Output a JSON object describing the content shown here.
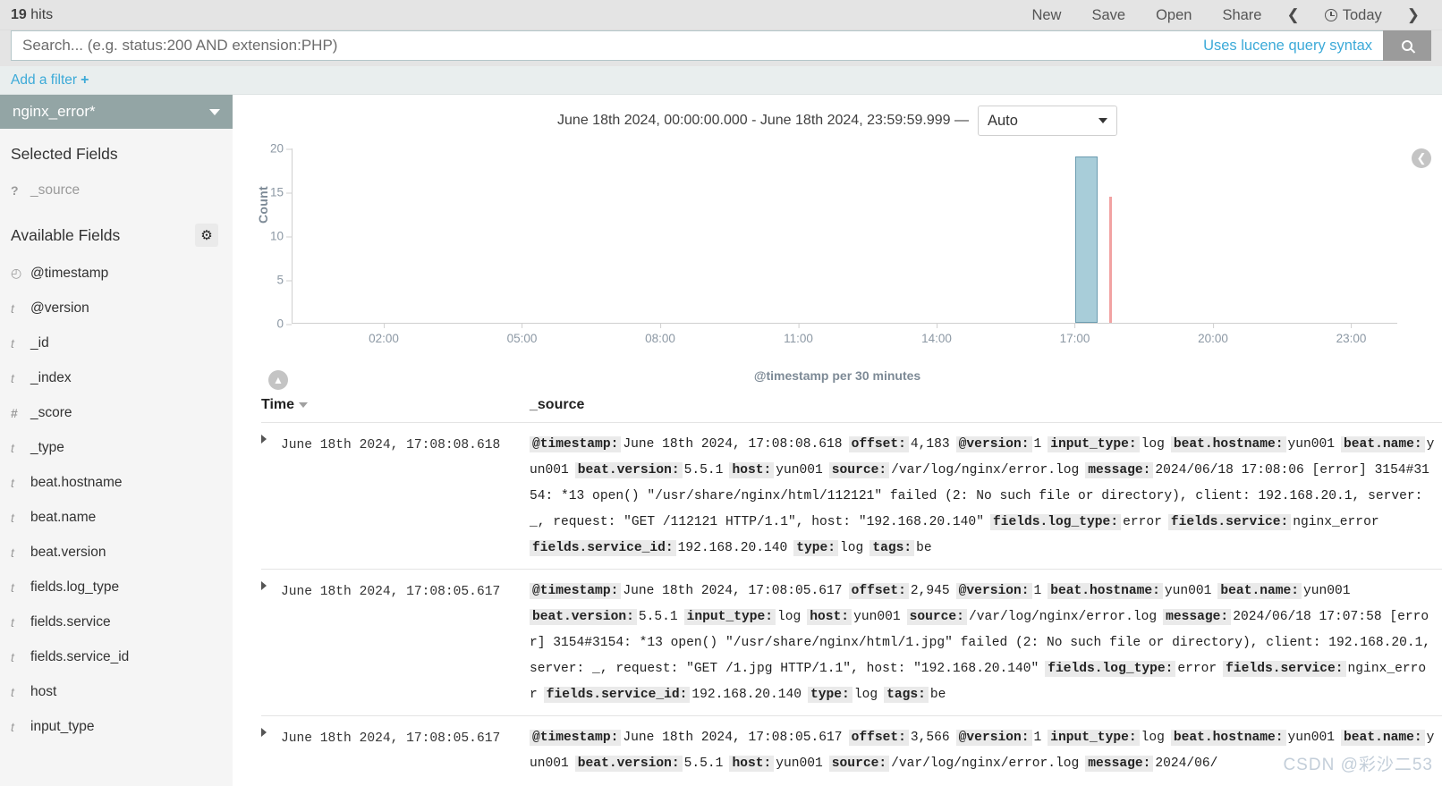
{
  "header": {
    "hits_count": "19",
    "hits_label": "hits",
    "nav": [
      {
        "label": "New",
        "name": "new-button"
      },
      {
        "label": "Save",
        "name": "save-button"
      },
      {
        "label": "Open",
        "name": "open-button"
      },
      {
        "label": "Share",
        "name": "share-button"
      }
    ],
    "prev_arrow": "❮",
    "next_arrow": "❯",
    "time_picker_label": "Today"
  },
  "search": {
    "placeholder": "Search... (e.g. status:200 AND extension:PHP)",
    "value": "",
    "hint": "Uses lucene query syntax",
    "button_icon": "search-icon"
  },
  "filters": {
    "add_filter_label": "Add a filter",
    "plus": "+"
  },
  "sidebar": {
    "index_pattern": "nginx_error*",
    "selected_fields_title": "Selected Fields",
    "selected_fields": [
      {
        "type": "?",
        "name": "_source"
      }
    ],
    "available_fields_title": "Available Fields",
    "settings_icon": "gear-icon",
    "available_fields": [
      {
        "type": "clock",
        "name": "@timestamp"
      },
      {
        "type": "t",
        "name": "@version"
      },
      {
        "type": "t",
        "name": "_id"
      },
      {
        "type": "t",
        "name": "_index"
      },
      {
        "type": "#",
        "name": "_score"
      },
      {
        "type": "t",
        "name": "_type"
      },
      {
        "type": "t",
        "name": "beat.hostname"
      },
      {
        "type": "t",
        "name": "beat.name"
      },
      {
        "type": "t",
        "name": "beat.version"
      },
      {
        "type": "t",
        "name": "fields.log_type"
      },
      {
        "type": "t",
        "name": "fields.service"
      },
      {
        "type": "t",
        "name": "fields.service_id"
      },
      {
        "type": "t",
        "name": "host"
      },
      {
        "type": "t",
        "name": "input_type"
      }
    ],
    "collapse_icon": "chevron-left-icon"
  },
  "chart": {
    "time_range": "June 18th 2024, 00:00:00.000 - June 18th 2024, 23:59:59.999 —",
    "interval_value": "Auto",
    "collapse_left_icon": "chevron-up-icon",
    "collapse_right_icon": "chevron-left-icon"
  },
  "chart_data": {
    "type": "bar",
    "title": "",
    "xlabel": "@timestamp per 30 minutes",
    "ylabel": "Count",
    "xtick_labels": [
      "02:00",
      "05:00",
      "08:00",
      "11:00",
      "14:00",
      "17:00",
      "20:00",
      "23:00"
    ],
    "xtick_hours": [
      2,
      5,
      8,
      11,
      14,
      17,
      20,
      23
    ],
    "ytick_labels": [
      "0",
      "5",
      "10",
      "15",
      "20"
    ],
    "ylim": [
      0,
      20
    ],
    "xlim_hours": [
      0,
      24
    ],
    "grid": false,
    "legend": null,
    "bars": [
      {
        "x_hour": 17.0,
        "width_hours": 0.5,
        "value": 19
      }
    ],
    "markers": [
      {
        "type": "current-time-line",
        "x_hour": 17.75,
        "color": "#f2a2a2"
      }
    ],
    "bar_color": "#a8cdd9",
    "bar_border_color": "#6b9cb0"
  },
  "table": {
    "columns": [
      {
        "label": "Time",
        "sortable": true
      },
      {
        "label": "_source",
        "sortable": false
      }
    ],
    "rows": [
      {
        "time": "June 18th 2024, 17:08:08.618",
        "fields": [
          {
            "key": "@timestamp:",
            "value": "June 18th 2024, 17:08:08.618"
          },
          {
            "key": "offset:",
            "value": "4,183"
          },
          {
            "key": "@version:",
            "value": "1"
          },
          {
            "key": "input_type:",
            "value": "log"
          },
          {
            "key": "beat.hostname:",
            "value": "yun001"
          },
          {
            "key": "beat.name:",
            "value": "yun001"
          },
          {
            "key": "beat.version:",
            "value": "5.5.1"
          },
          {
            "key": "host:",
            "value": "yun001"
          },
          {
            "key": "source:",
            "value": "/var/log/nginx/error.log"
          },
          {
            "key": "message:",
            "value": "2024/06/18 17:08:06 [error] 3154#3154: *13 open() \"/usr/share/nginx/html/112121\" failed (2: No such file or directory), client: 192.168.20.1, server: _, request: \"GET /112121 HTTP/1.1\", host: \"192.168.20.140\""
          },
          {
            "key": "fields.log_type:",
            "value": "error"
          },
          {
            "key": "fields.service:",
            "value": "nginx_error"
          },
          {
            "key": "fields.service_id:",
            "value": "192.168.20.140"
          },
          {
            "key": "type:",
            "value": "log"
          },
          {
            "key": "tags:",
            "value": "be"
          }
        ]
      },
      {
        "time": "June 18th 2024, 17:08:05.617",
        "fields": [
          {
            "key": "@timestamp:",
            "value": "June 18th 2024, 17:08:05.617"
          },
          {
            "key": "offset:",
            "value": "2,945"
          },
          {
            "key": "@version:",
            "value": "1"
          },
          {
            "key": "beat.hostname:",
            "value": "yun001"
          },
          {
            "key": "beat.name:",
            "value": "yun001"
          },
          {
            "key": "beat.version:",
            "value": "5.5.1"
          },
          {
            "key": "input_type:",
            "value": "log"
          },
          {
            "key": "host:",
            "value": "yun001"
          },
          {
            "key": "source:",
            "value": "/var/log/nginx/error.log"
          },
          {
            "key": "message:",
            "value": "2024/06/18 17:07:58 [error] 3154#3154: *13 open() \"/usr/share/nginx/html/1.jpg\" failed (2: No such file or directory), client: 192.168.20.1, server: _, request: \"GET /1.jpg HTTP/1.1\", host: \"192.168.20.140\""
          },
          {
            "key": "fields.log_type:",
            "value": "error"
          },
          {
            "key": "fields.service:",
            "value": "nginx_error"
          },
          {
            "key": "fields.service_id:",
            "value": "192.168.20.140"
          },
          {
            "key": "type:",
            "value": "log"
          },
          {
            "key": "tags:",
            "value": "be"
          }
        ]
      },
      {
        "time": "June 18th 2024, 17:08:05.617",
        "fields": [
          {
            "key": "@timestamp:",
            "value": "June 18th 2024, 17:08:05.617"
          },
          {
            "key": "offset:",
            "value": "3,566"
          },
          {
            "key": "@version:",
            "value": "1"
          },
          {
            "key": "input_type:",
            "value": "log"
          },
          {
            "key": "beat.hostname:",
            "value": "yun001"
          },
          {
            "key": "beat.name:",
            "value": "yun001"
          },
          {
            "key": "beat.version:",
            "value": "5.5.1"
          },
          {
            "key": "host:",
            "value": "yun001"
          },
          {
            "key": "source:",
            "value": "/var/log/nginx/error.log"
          },
          {
            "key": "message:",
            "value": "2024/06/"
          }
        ]
      }
    ]
  },
  "watermark": "CSDN @彩沙二53"
}
